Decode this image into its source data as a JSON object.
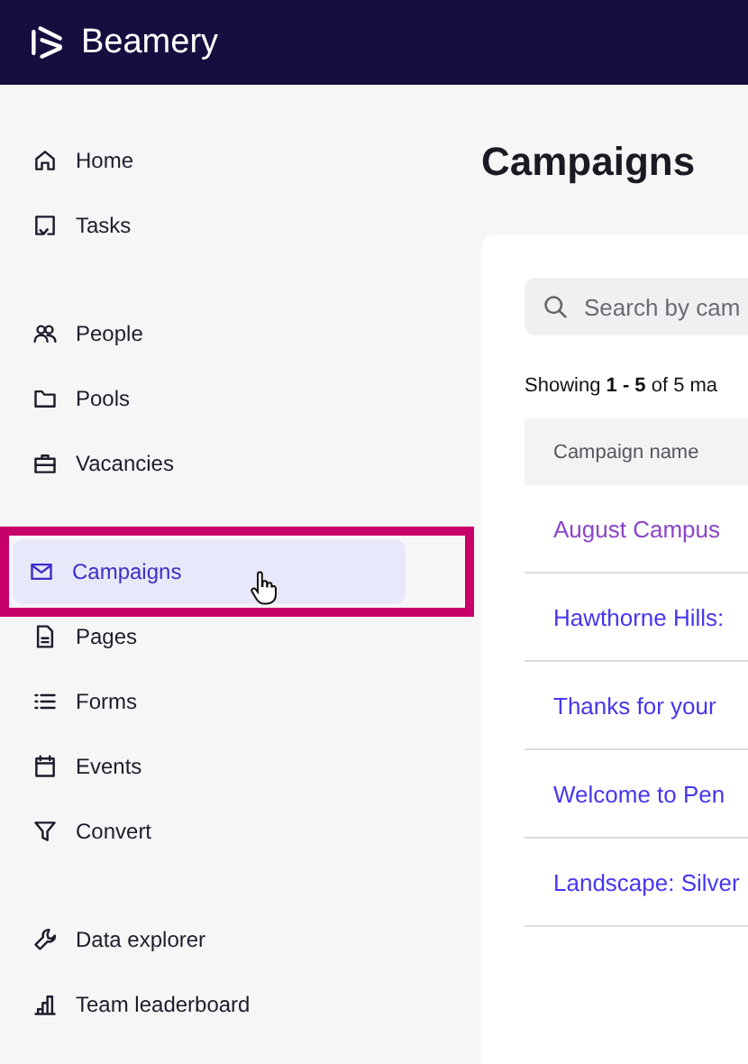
{
  "header": {
    "brand": "Beamery"
  },
  "sidebar": {
    "groups": [
      {
        "items": [
          {
            "label": "Home",
            "selected": false,
            "annotated": false
          },
          {
            "label": "Tasks",
            "selected": false,
            "annotated": false
          }
        ]
      },
      {
        "items": [
          {
            "label": "People",
            "selected": false,
            "annotated": false
          },
          {
            "label": "Pools",
            "selected": false,
            "annotated": false
          },
          {
            "label": "Vacancies",
            "selected": false,
            "annotated": false
          }
        ]
      },
      {
        "items": [
          {
            "label": "Campaigns",
            "selected": true,
            "annotated": true
          },
          {
            "label": "Pages",
            "selected": false,
            "annotated": false
          },
          {
            "label": "Forms",
            "selected": false,
            "annotated": false
          },
          {
            "label": "Events",
            "selected": false,
            "annotated": false
          },
          {
            "label": "Convert",
            "selected": false,
            "annotated": false
          }
        ]
      },
      {
        "items": [
          {
            "label": "Data explorer",
            "selected": false,
            "annotated": false
          },
          {
            "label": "Team leaderboard",
            "selected": false,
            "annotated": false
          }
        ]
      }
    ]
  },
  "main": {
    "title": "Campaigns",
    "search": {
      "placeholder": "Search by cam"
    },
    "summary": "Showing **1 - 5** of 5 ma",
    "table": {
      "columns": [
        "Campaign name"
      ],
      "rows": [
        {
          "name": "August Campus",
          "visited": true
        },
        {
          "name": "Hawthorne Hills:",
          "visited": false
        },
        {
          "name": "Thanks for your",
          "visited": false
        },
        {
          "name": "Welcome to Pen",
          "visited": false
        },
        {
          "name": "Landscape: Silver",
          "visited": false
        }
      ]
    }
  }
}
